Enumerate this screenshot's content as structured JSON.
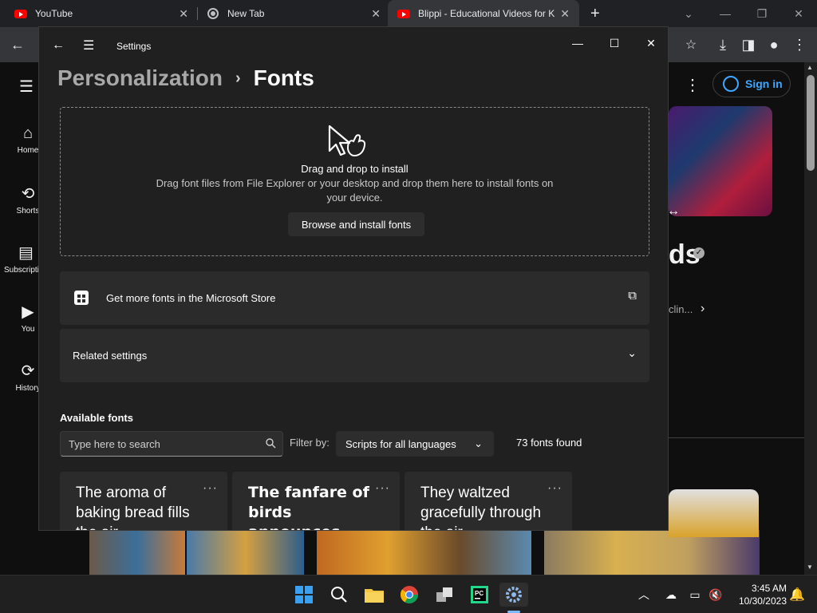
{
  "browser": {
    "tabs": [
      {
        "title": "YouTube"
      },
      {
        "title": "New Tab"
      },
      {
        "title": "Blippi - Educational Videos for K"
      }
    ]
  },
  "youtube": {
    "nav": [
      {
        "label": "Home"
      },
      {
        "label": "Shorts"
      },
      {
        "label": "Subscriptions"
      },
      {
        "label": "You"
      },
      {
        "label": "History"
      }
    ],
    "signin_label": "Sign in",
    "channel_fragment": "ds",
    "desc_fragment": "clin..."
  },
  "settings": {
    "window_title": "Settings",
    "breadcrumb": {
      "parent": "Personalization",
      "current": "Fonts"
    },
    "drop": {
      "heading": "Drag and drop to install",
      "description": "Drag font files from File Explorer or your desktop and drop them here to install fonts on your device.",
      "button": "Browse and install fonts"
    },
    "store_link": "Get more fonts in the Microsoft Store",
    "related_settings": "Related settings",
    "available_title": "Available fonts",
    "search_placeholder": "Type here to search",
    "filter_label": "Filter by:",
    "filter_value": "Scripts for all languages",
    "count": "73 fonts found",
    "font_previews": [
      {
        "text": "The aroma of baking bread fills the air"
      },
      {
        "text": "The fanfare of birds announces the morning"
      },
      {
        "text": "They waltzed gracefully through the air"
      }
    ]
  },
  "taskbar": {
    "time": "3:45 AM",
    "date": "10/30/2023"
  }
}
